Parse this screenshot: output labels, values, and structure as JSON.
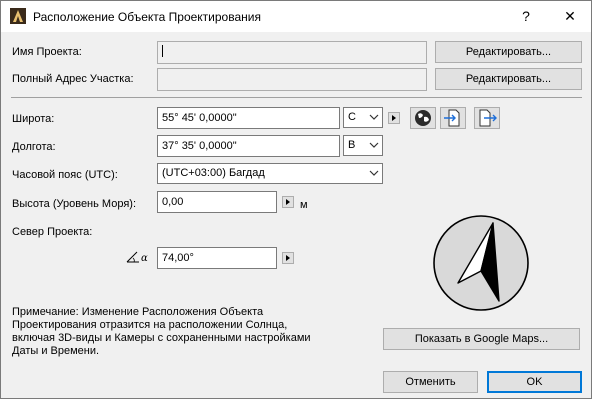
{
  "window": {
    "title": "Расположение Объекта Проектирования",
    "help_label": "?",
    "close_label": "✕"
  },
  "project": {
    "name_label": "Имя Проекта:",
    "name_value": "",
    "address_label": "Полный Адрес Участка:",
    "address_value": "",
    "edit_label": "Редактировать..."
  },
  "location": {
    "latitude_label": "Широта:",
    "latitude_value": "55° 45' 0,0000\"",
    "latitude_dir": "С",
    "longitude_label": "Долгота:",
    "longitude_value": "37° 35' 0,0000\"",
    "longitude_dir": "В",
    "timezone_label": "Часовой пояс (UTC):",
    "timezone_value": "(UTC+03:00) Багдад",
    "altitude_label": "Высота (Уровень Моря):",
    "altitude_value": "0,00",
    "altitude_unit": "м",
    "north_label": "Север Проекта:",
    "north_value": "74,00°"
  },
  "note": "Примечание: Изменение Расположения Объекта Проектирования отразится на расположении Солнца, включая 3D-виды и Камеры с сохраненными настройками Даты и Времени.",
  "buttons": {
    "google_maps": "Показать в Google Maps...",
    "cancel": "Отменить",
    "ok": "OK"
  },
  "icons": {
    "app": "archicad-icon",
    "globe": "globe-icon",
    "import": "import-icon",
    "export": "export-icon",
    "compass": "compass-icon"
  }
}
